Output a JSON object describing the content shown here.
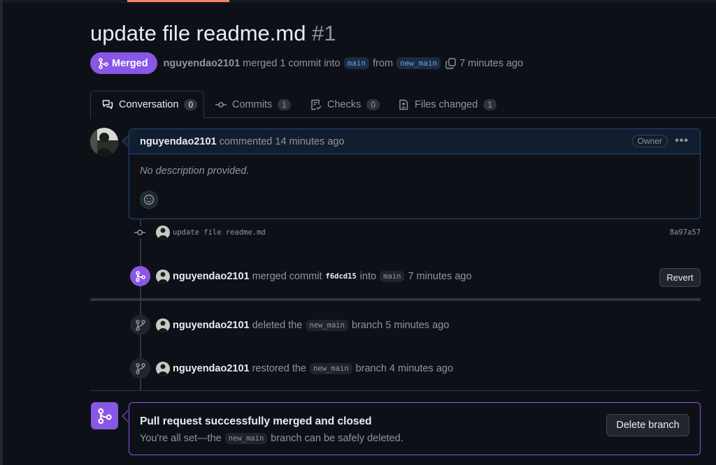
{
  "pr": {
    "title": "update file readme.md",
    "number": "#1",
    "state_label": "Merged",
    "author": "nguyendao2101",
    "merged_text": "merged 1 commit into",
    "base_branch": "main",
    "from_text": "from",
    "head_branch": "new_main",
    "time": "7 minutes ago"
  },
  "tabs": [
    {
      "label": "Conversation",
      "count": "0"
    },
    {
      "label": "Commits",
      "count": "1"
    },
    {
      "label": "Checks",
      "count": "0"
    },
    {
      "label": "Files changed",
      "count": "1"
    }
  ],
  "comment": {
    "author": "nguyendao2101",
    "action": "commented 14 minutes ago",
    "owner_badge": "Owner",
    "body": "No description provided."
  },
  "commit": {
    "message": "update file readme.md",
    "sha": "8a97a57"
  },
  "merge_event": {
    "author": "nguyendao2101",
    "text1": "merged commit",
    "sha": "f6dcd15",
    "text2": "into",
    "branch": "main",
    "time": "7 minutes ago",
    "revert_label": "Revert"
  },
  "delete_event": {
    "author": "nguyendao2101",
    "text1": "deleted the",
    "branch": "new_main",
    "text2": "branch 5 minutes ago"
  },
  "restore_event": {
    "author": "nguyendao2101",
    "text1": "restored the",
    "branch": "new_main",
    "text2": "branch 4 minutes ago"
  },
  "merged_box": {
    "title": "Pull request successfully merged and closed",
    "sub1": "You're all set—the",
    "branch": "new_main",
    "sub2": "branch can be safely deleted.",
    "delete_label": "Delete branch"
  },
  "colors": {
    "merged": "#8957e5",
    "accent_link": "#58a6ff",
    "background": "#0d1117"
  }
}
